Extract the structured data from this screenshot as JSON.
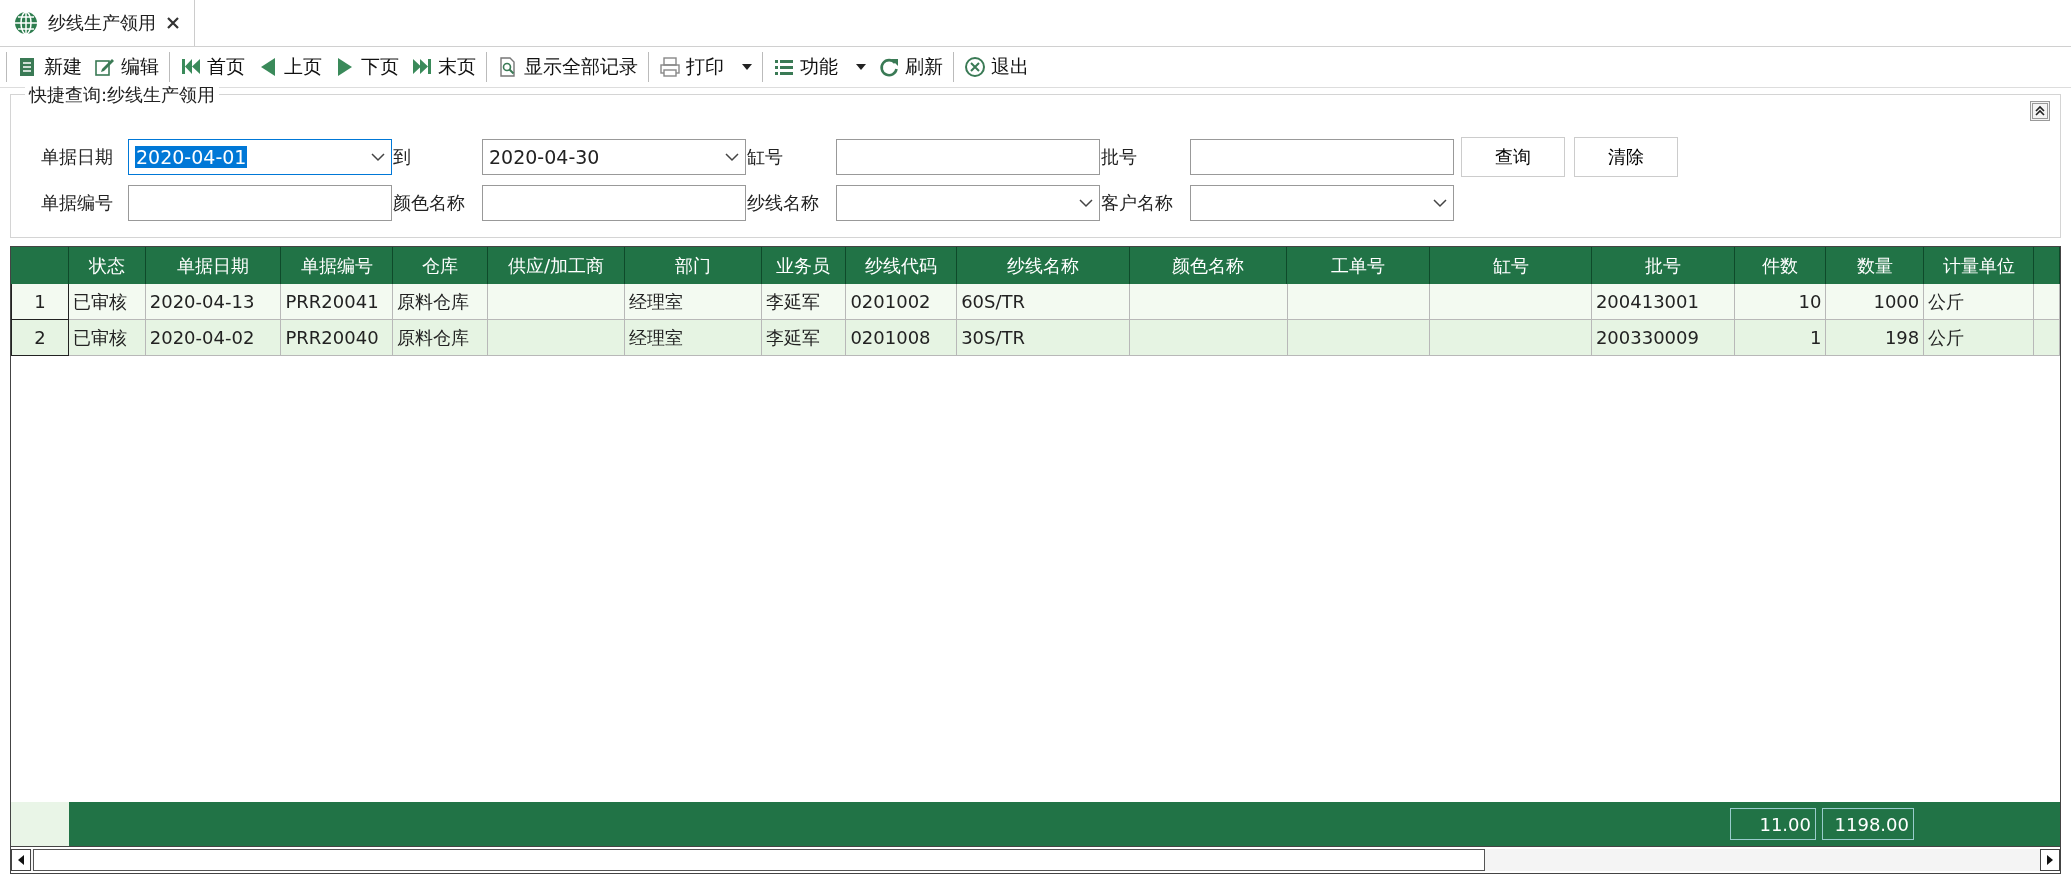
{
  "tabs": [
    {
      "label": "纱线生产领用",
      "selected": true
    }
  ],
  "toolbar": {
    "groups": [
      {
        "buttons": [
          {
            "label": "新建",
            "dropdown": false
          },
          {
            "label": "编辑",
            "dropdown": false
          }
        ]
      },
      {
        "buttons": [
          {
            "label": "首页",
            "dropdown": false
          },
          {
            "label": "上页",
            "dropdown": false
          },
          {
            "label": "下页",
            "dropdown": false
          },
          {
            "label": "末页",
            "dropdown": false
          }
        ]
      },
      {
        "buttons": [
          {
            "label": "显示全部记录",
            "dropdown": false
          }
        ]
      },
      {
        "buttons": [
          {
            "label": "打印",
            "dropdown": true
          }
        ]
      },
      {
        "buttons": [
          {
            "label": "功能",
            "dropdown": true
          },
          {
            "label": "刷新",
            "dropdown": false
          }
        ]
      },
      {
        "buttons": [
          {
            "label": "退出",
            "dropdown": false
          }
        ]
      }
    ]
  },
  "query": {
    "title": "快捷查询:纱线生产领用",
    "rows": [
      [
        {
          "label": "单据日期",
          "kind": "date",
          "value": "2020-04-01",
          "focused": true
        },
        {
          "label": "到",
          "kind": "date",
          "value": "2020-04-30",
          "focused": false
        },
        {
          "label": "缸号",
          "kind": "text",
          "focused": false
        },
        {
          "label": "批号",
          "kind": "text",
          "focused": false
        }
      ],
      [
        {
          "label": "单据编号",
          "kind": "text",
          "focused": false
        },
        {
          "label": "颜色名称",
          "kind": "text",
          "focused": false
        },
        {
          "label": "纱线名称",
          "kind": "combo",
          "focused": false
        },
        {
          "label": "客户名称",
          "kind": "combo",
          "focused": false
        }
      ]
    ],
    "buttons": [
      "查询",
      "清除"
    ]
  },
  "table": {
    "columns": [
      "状态",
      "单据日期",
      "单据编号",
      "仓库",
      "供应/加工商",
      "部门",
      "业务员",
      "纱线代码",
      "纱线名称",
      "颜色名称",
      "工单号",
      "缸号",
      "批号",
      "件数",
      "数量",
      "计量单位"
    ],
    "rows": [
      {
        "number": "1",
        "cells": [
          "已审核",
          "2020-04-13",
          "PRR20041",
          "原料仓库",
          null,
          "经理室",
          "李延军",
          "0201002",
          "60S/TR",
          null,
          null,
          null,
          "200413001",
          "10",
          "1000",
          "公斤"
        ]
      },
      {
        "number": "2",
        "cells": [
          "已审核",
          "2020-04-02",
          "PRR20040",
          "原料仓库",
          null,
          "经理室",
          "李延军",
          "0201008",
          "30S/TR",
          null,
          null,
          null,
          "200330009",
          "1",
          "198",
          "公斤"
        ]
      }
    ],
    "totals": [
      "11.00",
      "1198.00"
    ]
  }
}
